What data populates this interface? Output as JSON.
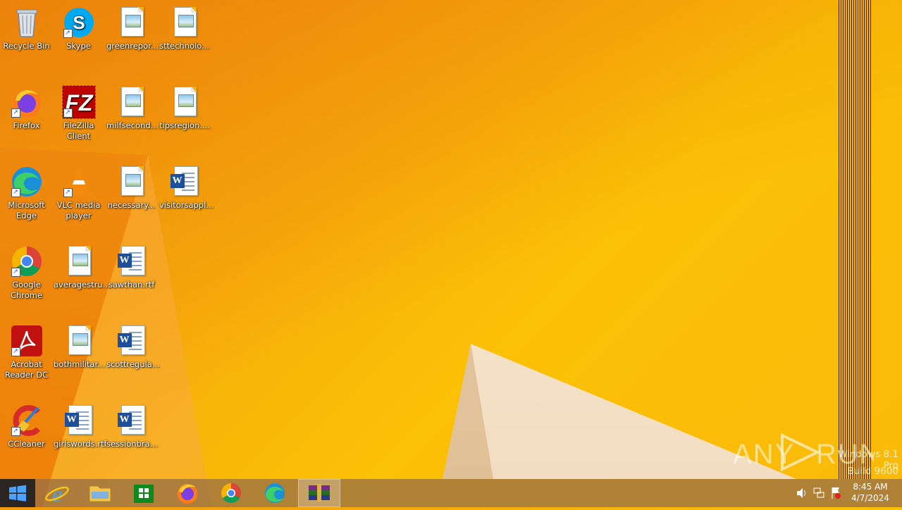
{
  "desktop_icons": [
    {
      "label": "Recycle Bin"
    },
    {
      "label": "Skype"
    },
    {
      "label": "greenrepor..."
    },
    {
      "label": "sttechnolo..."
    },
    {
      "label": "Firefox"
    },
    {
      "label": "FileZilla Client"
    },
    {
      "label": "milfsecond..."
    },
    {
      "label": "tipsregion...."
    },
    {
      "label": "Microsoft Edge"
    },
    {
      "label": "VLC media player"
    },
    {
      "label": "necessary..."
    },
    {
      "label": "visitorsappl..."
    },
    {
      "label": "Google Chrome"
    },
    {
      "label": "averagestru..."
    },
    {
      "label": "sawthan.rtf"
    },
    {
      "label": "Acrobat Reader DC"
    },
    {
      "label": "bothmilitar..."
    },
    {
      "label": "scottregula..."
    },
    {
      "label": "CCleaner"
    },
    {
      "label": "girlswords.rtf"
    },
    {
      "label": "sessionbra..."
    }
  ],
  "taskbar": {
    "apps": [
      "start-button",
      "internet-explorer",
      "file-explorer",
      "store",
      "firefox",
      "chrome",
      "edge",
      "winrar"
    ]
  },
  "tray": {
    "time": "8:45 AM",
    "date": "4/7/2024"
  },
  "watermark": {
    "brand": "ANY RUN",
    "os_line1": "Windows 8.1 Pro",
    "os_line2": "Build 9600"
  },
  "colors": {
    "wallpaper": "#fbc106",
    "taskbar": "#96704a"
  }
}
